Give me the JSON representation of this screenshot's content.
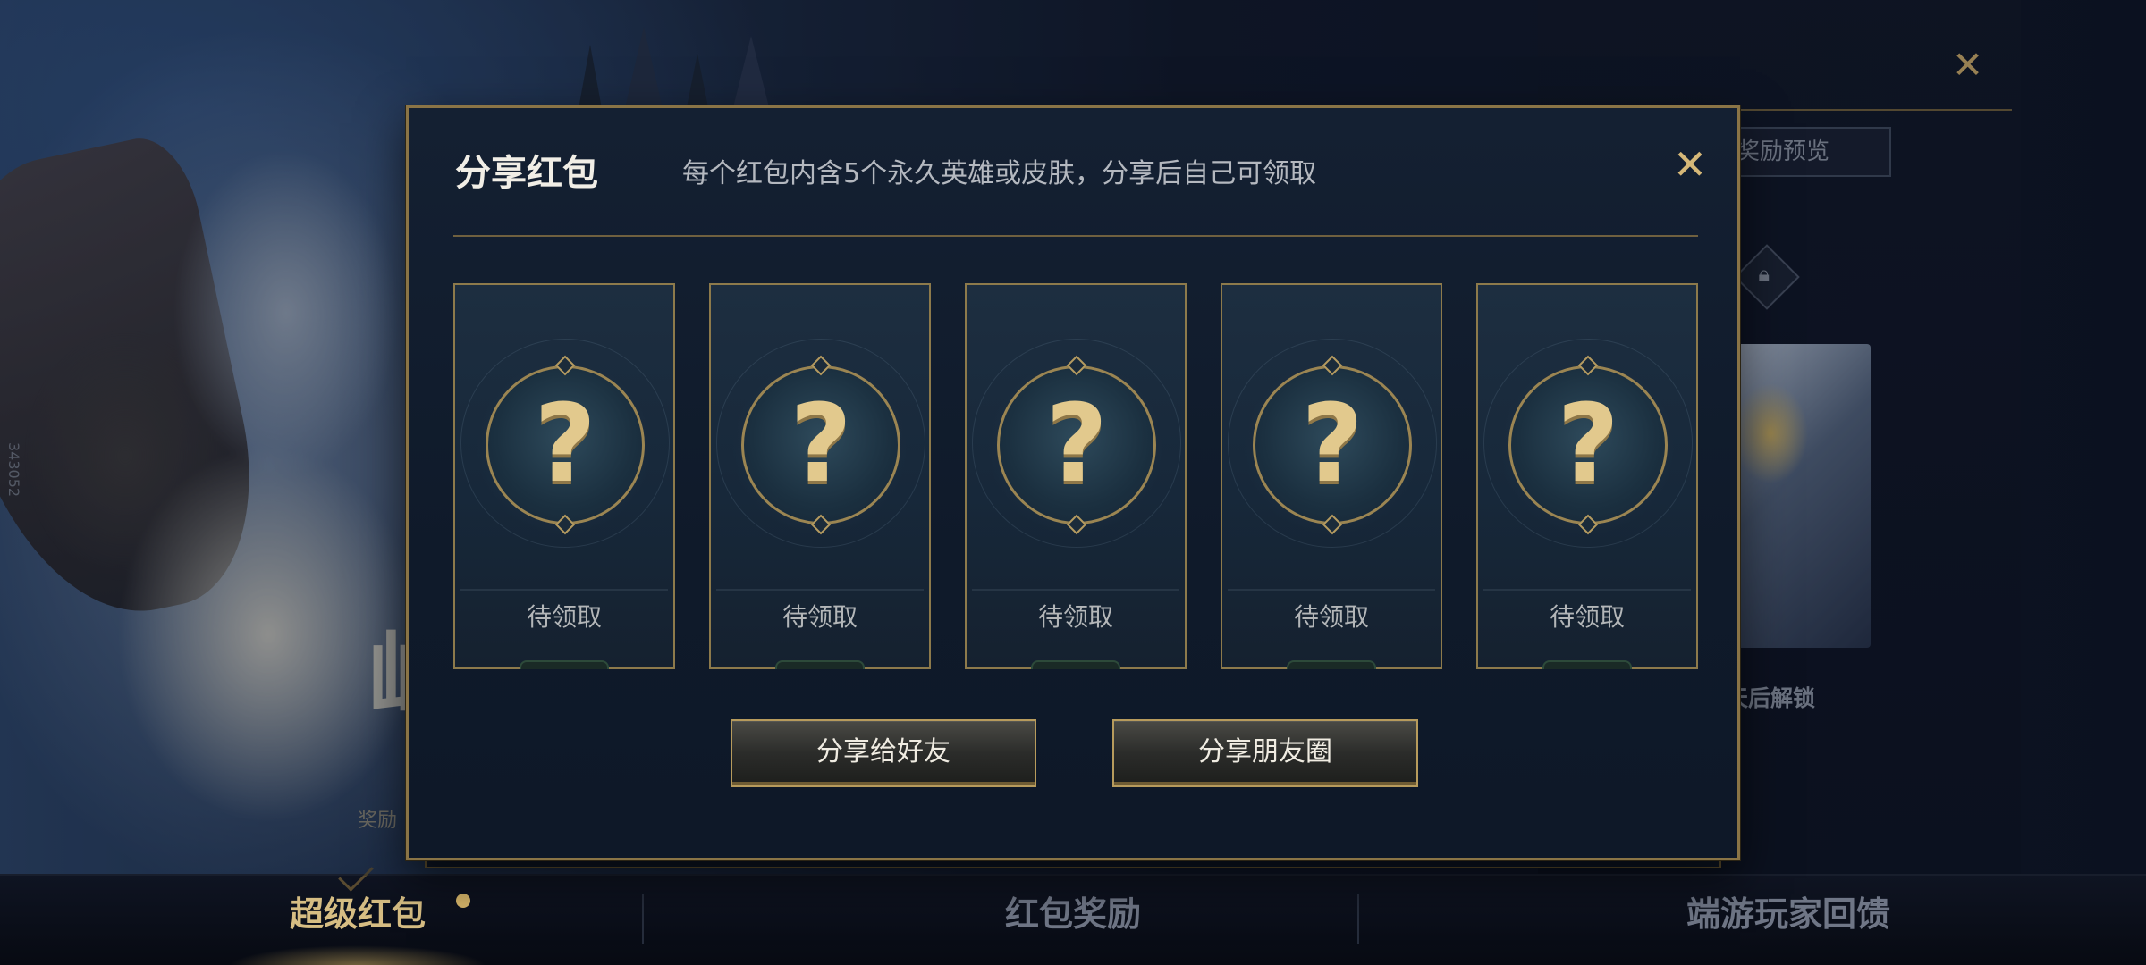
{
  "background": {
    "big_glyph": "屾",
    "small_text": "奖励",
    "vertical_id": "343052",
    "right_panel": {
      "preview_label": "奖励预览",
      "unlock_label": "天后解锁"
    }
  },
  "modal": {
    "title": "分享红包",
    "subtitle": "每个红包内含5个永久英雄或皮肤，分享后自己可领取",
    "close_symbol": "✕",
    "cards": [
      {
        "mark": "?",
        "status": "待领取"
      },
      {
        "mark": "?",
        "status": "待领取"
      },
      {
        "mark": "?",
        "status": "待领取"
      },
      {
        "mark": "?",
        "status": "待领取"
      },
      {
        "mark": "?",
        "status": "待领取"
      }
    ],
    "buttons": {
      "share_friend": "分享给好友",
      "share_moments": "分享朋友圈"
    }
  },
  "bottom_nav": {
    "tabs": [
      {
        "label": "超级红包",
        "active": true
      },
      {
        "label": "红包奖励",
        "active": false
      },
      {
        "label": "端游玩家回馈",
        "active": false
      }
    ]
  },
  "colors": {
    "accent_gold": "#d6bd83",
    "modal_border": "#8a7446",
    "modal_bg": "#142032"
  },
  "icons": [
    "close-icon",
    "question-mark-icon",
    "lock-icon"
  ]
}
